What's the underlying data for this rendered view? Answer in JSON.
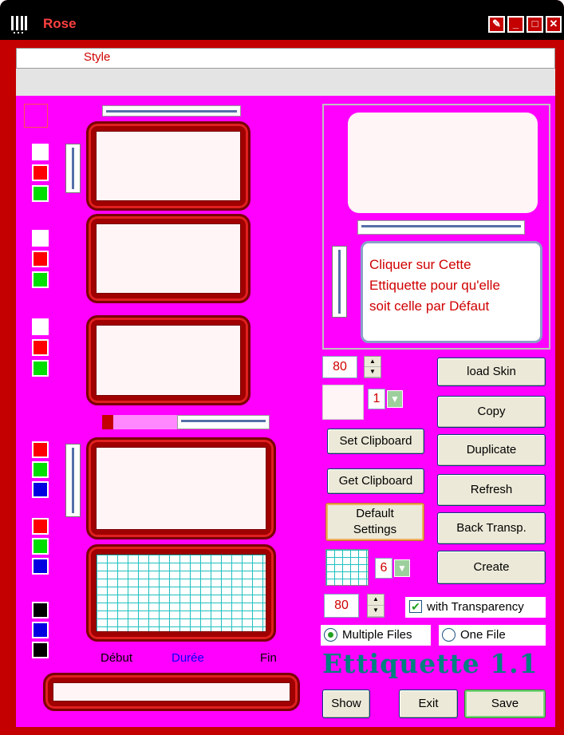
{
  "window": {
    "title": "Rose"
  },
  "menu": {
    "style": "Style"
  },
  "preview": {
    "label_text_line1": "Cliquer sur Cette",
    "label_text_line2": "Ettiquette pour qu'elle",
    "label_text_line3": "soit celle par Défaut"
  },
  "controls": {
    "size_top": "80",
    "size_bottom": "80",
    "drop1_value": "1",
    "drop2_value": "6",
    "set_clipboard": "Set Clipboard",
    "get_clipboard": "Get Clipboard",
    "default_settings_line1": "Default",
    "default_settings_line2": "Settings",
    "load_skin": "load Skin",
    "copy": "Copy",
    "duplicate": "Duplicate",
    "refresh": "Refresh",
    "back_transp": "Back Transp.",
    "create": "Create",
    "with_transparency": "with Transparency",
    "with_transparency_checked": true,
    "multiple_files": "Multiple Files",
    "one_file": "One File",
    "selected_mode": "Multiple Files",
    "show": "Show",
    "exit": "Exit",
    "save": "Save"
  },
  "timeline": {
    "debut": "Début",
    "duree": "Durée",
    "fin": "Fin"
  },
  "brand": "Ettiquette 1.1",
  "colors": {
    "background": "#ff00ff",
    "frame": "#c40000",
    "brand": "#008080",
    "duree": "#0000ff"
  }
}
